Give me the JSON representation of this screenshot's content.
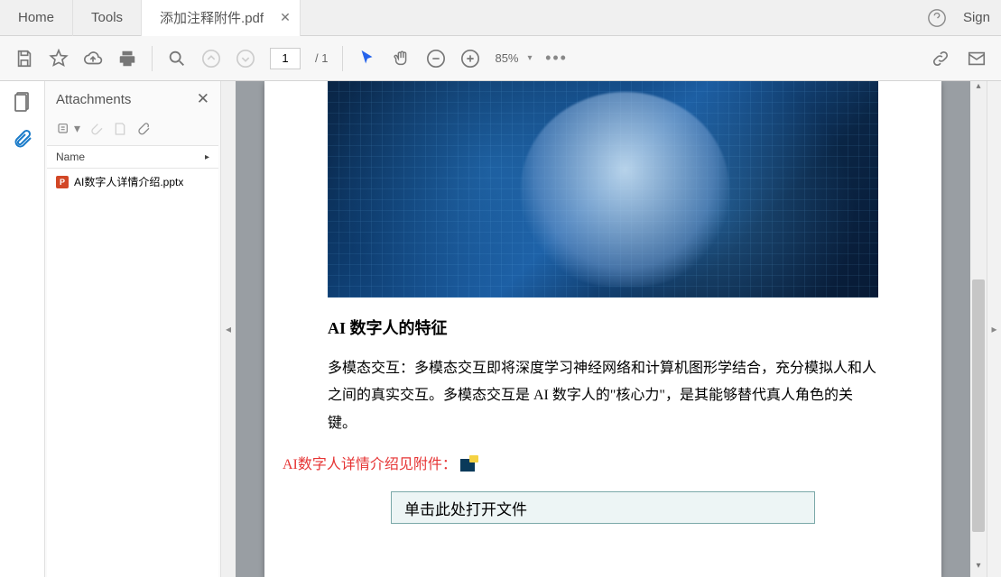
{
  "tabs": {
    "home": "Home",
    "tools": "Tools",
    "doc_title": "添加注释附件.pdf"
  },
  "top_right": {
    "signin": "Sign"
  },
  "toolbar": {
    "page_current": "1",
    "page_total": "/ 1",
    "zoom_value": "85%"
  },
  "sidepanel": {
    "title": "Attachments",
    "col_name": "Name",
    "items": [
      {
        "icon": "P",
        "filename": "AI数字人详情介绍.pptx"
      }
    ]
  },
  "document": {
    "heading": "AI 数字人的特征",
    "paragraph": "多模态交互：多模态交互即将深度学习神经网络和计算机图形学结合，充分模拟人和人之间的真实交互。多模态交互是 AI 数字人的\"核心力\"，是其能够替代真人角色的关键。",
    "attachment_label": "AI数字人详情介绍见附件：",
    "open_button": "单击此处打开文件"
  }
}
